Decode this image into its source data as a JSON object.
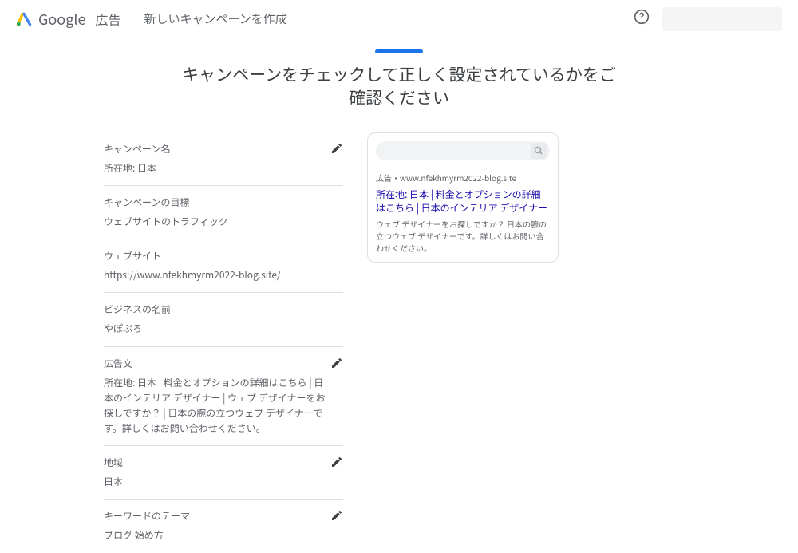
{
  "header": {
    "brand": "Google",
    "brand_suffix": "広告",
    "page_title": "新しいキャンペーンを作成"
  },
  "main_title": "キャンペーンをチェックして正しく設定されているかをご確認ください",
  "sections": {
    "campaign_name": {
      "label": "キャンペーン名",
      "value": "所在地: 日本",
      "editable": true
    },
    "goal": {
      "label": "キャンペーンの目標",
      "value": "ウェブサイトのトラフィック",
      "editable": false
    },
    "website": {
      "label": "ウェブサイト",
      "value": "https://www.nfekhmyrm2022-blog.site/",
      "editable": false
    },
    "business_name": {
      "label": "ビジネスの名前",
      "value": "やぽぷろ",
      "editable": false
    },
    "ad_text": {
      "label": "広告文",
      "value": "所在地: 日本 | 料金とオプションの詳細はこちら | 日本のインテリア デザイナー | ウェブ デザイナーをお探しですか？ | 日本の腕の立つウェブ デザイナーです。詳しくはお問い合わせください。",
      "editable": true
    },
    "region": {
      "label": "地域",
      "value": "日本",
      "editable": true
    },
    "keywords": {
      "label": "キーワードのテーマ",
      "value": "ブログ 始め方",
      "editable": true
    }
  },
  "preview": {
    "ad_label": "広告・www.nfekhmyrm2022-blog.site",
    "headline": "所在地: 日本 | 料金とオプションの詳細はこちら | 日本のインテリア デザイナー",
    "description": "ウェブ デザイナーをお探しですか？ 日本の腕の立つウェブ デザイナーです。詳しくはお問い合わせください。"
  }
}
